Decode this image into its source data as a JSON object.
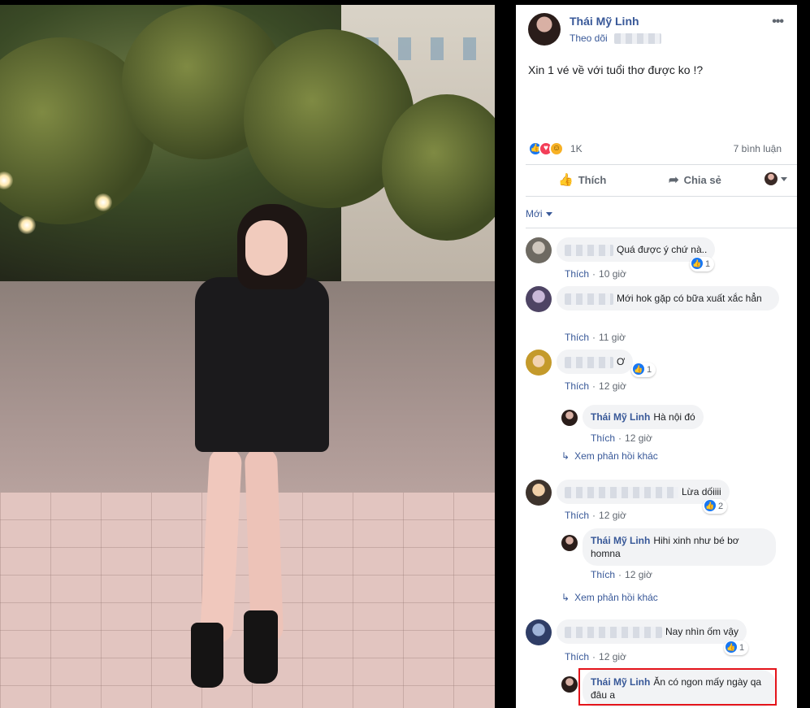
{
  "post": {
    "author": "Thái Mỹ Linh",
    "follow_label": "Theo dõi",
    "text": "Xin 1 vé về với tuổi thơ được ko !?",
    "more_icon": "more-horizontal-icon",
    "reaction_count": "1K",
    "comment_count": "7 bình luận",
    "like_label": "Thích",
    "share_label": "Chia sẻ",
    "sort_label": "Mới",
    "colors": {
      "link": "#385898",
      "like": "#1877f2",
      "love": "#f33e58",
      "highlight": "#e4141b"
    }
  },
  "comments": [
    {
      "text": "Quá được ý chứ nà..",
      "like": "Thích",
      "time": "10 giờ",
      "likes": "1"
    },
    {
      "text": "Mới hok gặp có bữa xuất xắc hẳn",
      "like": "Thích",
      "time": "11 giờ"
    },
    {
      "text": "Ơ",
      "like": "Thích",
      "time": "12 giờ",
      "likes": "1",
      "reply": {
        "author": "Thái Mỹ Linh",
        "text": "Hà nội đó",
        "like": "Thích",
        "time": "12 giờ"
      },
      "more_replies": "Xem phản hồi khác"
    },
    {
      "text": "Lừa dốiiii",
      "like": "Thích",
      "time": "12 giờ",
      "likes": "2",
      "reply": {
        "author": "Thái Mỹ Linh",
        "text": "Hihi xinh như bé bơ homna",
        "like": "Thích",
        "time": "12 giờ"
      },
      "more_replies": "Xem phản hồi khác"
    },
    {
      "text": "Nay nhìn ốm vậy",
      "like": "Thích",
      "time": "12 giờ",
      "likes": "1",
      "reply": {
        "author": "Thái Mỹ Linh",
        "text": "Ăn có ngon mấy ngày qa đâu a"
      }
    }
  ]
}
